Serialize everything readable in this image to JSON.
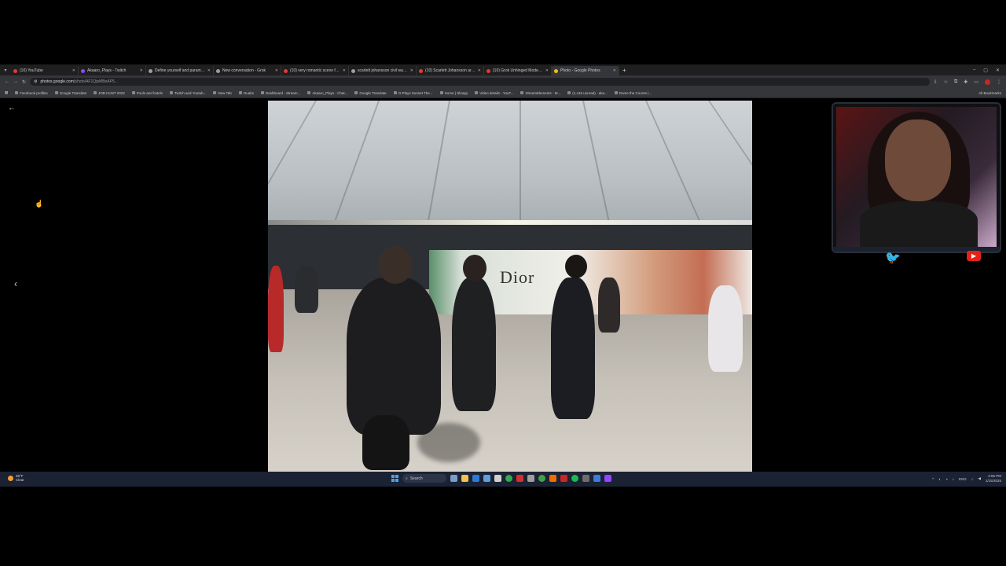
{
  "browser": {
    "tabs": [
      {
        "title": "(10) YouTube",
        "color": "#e53935"
      },
      {
        "title": "Akaaro_Plays - Twitch",
        "color": "#9146ff"
      },
      {
        "title": "Define yourself and parameter...",
        "color": "#9aa0a6"
      },
      {
        "title": "New conversation - Grok",
        "color": "#9aa0a6"
      },
      {
        "title": "(10) very romantic scene from...",
        "color": "#e53935"
      },
      {
        "title": "scarlett johansson civil war pr...",
        "color": "#9aa0a6"
      },
      {
        "title": "(10) Scarlett Johansson arrive...",
        "color": "#e53935"
      },
      {
        "title": "(10) Grok Unhinged Mode in G...",
        "color": "#e53935"
      },
      {
        "title": "Photo - Google Photos",
        "color": "#fbbc04",
        "active": true
      }
    ],
    "url": "photos.google.com",
    "url_rest": "/photo/AF1QipMBoAP5...",
    "bookmarks": [
      "Facebook profiles",
      "Google Translate",
      "JOB HUNT 2023",
      "Pools and hotels",
      "Twitch and Youtub...",
      "New Tab",
      "Ouabs",
      "Dashboard - Stream...",
      "Akaaro_Plays - Chat...",
      "Google Translate",
      "O-Plays Sunset The...",
      "Home | Skrapy",
      "Video details - YouT...",
      "StreamElements - M...",
      "(1,415 unread) - aka...",
      "Dome the Course |..."
    ],
    "all_bookmarks": "All Bookmarks"
  },
  "viewer": {
    "back_icon": "←",
    "prev_icon": "‹",
    "photo_sign": "Dior"
  },
  "overlay": {
    "twitter_icon": "🐦",
    "youtube_icon": "▶"
  },
  "taskbar": {
    "weather_temp": "36°F",
    "weather_cond": "Clear",
    "search_label": "Search",
    "lang": "ENG",
    "time": "2:55 PM",
    "date": "1/15/2025"
  }
}
